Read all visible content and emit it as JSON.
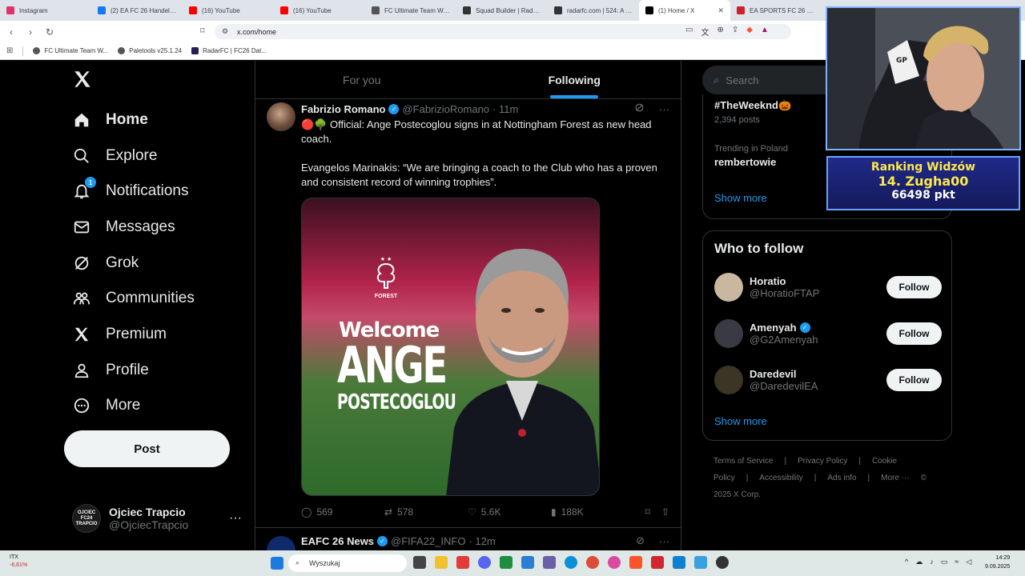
{
  "browser": {
    "tabs": [
      {
        "label": "Instagram",
        "color": "#e1306c"
      },
      {
        "label": "(2) EA FC 26 Handel, Z...",
        "color": "#1877f2"
      },
      {
        "label": "(16) YouTube",
        "color": "#ff0000"
      },
      {
        "label": "(16) YouTube",
        "color": "#ff0000"
      },
      {
        "label": "FC Ultimate Team Web...",
        "color": "#555555"
      },
      {
        "label": "Squad Builder | RadarF...",
        "color": "#333333"
      },
      {
        "label": "radarfc.com | 524: A ti...",
        "color": "#333333"
      },
      {
        "label": "(1) Home / X",
        "color": "#000000"
      },
      {
        "label": "EA SPORTS FC 26 Play...",
        "color": "#d0202a"
      }
    ],
    "url": "x.com/home",
    "bookmarks": [
      "FC Ultimate Team W...",
      "Paletools v25.1.24",
      "RadarFC | FC26 Dat..."
    ]
  },
  "nav": {
    "items": [
      {
        "label": "Home",
        "icon": "home-icon"
      },
      {
        "label": "Explore",
        "icon": "search-icon"
      },
      {
        "label": "Notifications",
        "icon": "bell-icon",
        "badge": "1"
      },
      {
        "label": "Messages",
        "icon": "envelope-icon"
      },
      {
        "label": "Grok",
        "icon": "grok-icon"
      },
      {
        "label": "Communities",
        "icon": "people-icon"
      },
      {
        "label": "Premium",
        "icon": "x-icon"
      },
      {
        "label": "Profile",
        "icon": "person-icon"
      },
      {
        "label": "More",
        "icon": "more-circle-icon"
      }
    ],
    "post_label": "Post",
    "account": {
      "name": "Ojciec Trapcio",
      "handle": "@OjciecTrapcio",
      "avatar_text": "OJCIEC FC24 TRAPCIO"
    }
  },
  "timeline": {
    "tabs": [
      "For you",
      "Following"
    ],
    "selected_tab": "Following",
    "tweet": {
      "name": "Fabrizio Romano",
      "handle": "@FabrizioRomano",
      "time": "· 11m",
      "text": "🔴🌳 Official: Ange Postecoglou signs in at Nottingham Forest as new head coach.\n\nEvangelos Marinakis: “We are bringing a coach to the Club who has a proven and consistent record of winning trophies”.",
      "media": {
        "welcome": "Welcome",
        "first": "ANGE",
        "last": "POSTECOGLOU",
        "crest_text": "FOREST"
      },
      "replies": "569",
      "reposts": "578",
      "likes": "5.6K",
      "views": "188K"
    },
    "tweet2": {
      "name": "EAFC 26 News",
      "handle": "@FIFA22_INFO",
      "time": "· 12m"
    }
  },
  "sidebar": {
    "search_placeholder": "Search",
    "trends": [
      {
        "context": "",
        "name": "#TheWeeknd🎃",
        "count": "2,394 posts"
      },
      {
        "context": "Trending in Poland",
        "name": "rembertowie",
        "count": ""
      }
    ],
    "show_more": "Show more",
    "who_to_follow_title": "Who to follow",
    "suggestions": [
      {
        "name": "Horatio",
        "handle": "@HoratioFTAP",
        "verified": false,
        "color": "#c9b7a0"
      },
      {
        "name": "Amenyah",
        "handle": "@G2Amenyah",
        "verified": true,
        "color": "#3a3a44"
      },
      {
        "name": "Daredevil",
        "handle": "@DaredevilEA",
        "verified": false,
        "color": "#3b3526"
      }
    ],
    "follow_label": "Follow",
    "footer": [
      "Terms of Service",
      "|",
      "Privacy Policy",
      "|",
      "Cookie Policy",
      "|",
      "Accessibility",
      "|",
      "Ads info",
      "|",
      "More ···",
      "© 2025 X Corp."
    ]
  },
  "overlay": {
    "ranking_title": "Ranking Widzów",
    "ranking_line": "14. Zugha00",
    "ranking_points": "66498 pkt"
  },
  "taskbar": {
    "weather_name": "ITX",
    "weather_pct": "-6,61%",
    "search_placeholder": "Wyszukaj",
    "time": "14:29",
    "date": "9.09.2025"
  }
}
